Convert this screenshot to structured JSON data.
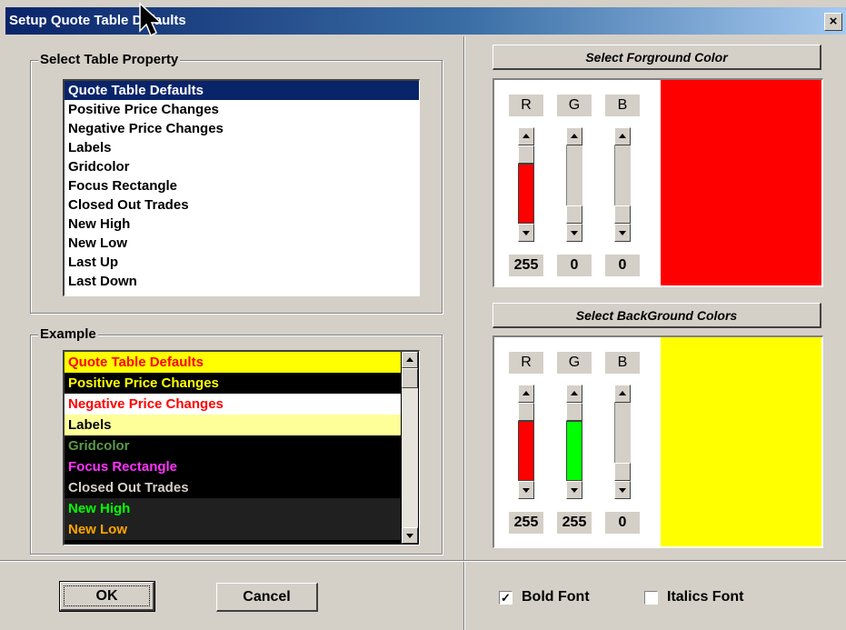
{
  "window": {
    "title": "Setup Quote Table Defaults",
    "close_glyph": "×"
  },
  "property_group": {
    "legend": "Select Table Property",
    "items": [
      "Quote Table Defaults",
      "Positive Price Changes",
      "Negative Price Changes",
      "Labels",
      "Gridcolor",
      "Focus Rectangle",
      "Closed Out Trades",
      "New High",
      "New Low",
      "Last Up",
      "Last Down"
    ],
    "selected_index": 0
  },
  "example_group": {
    "legend": "Example",
    "items": [
      {
        "label": "Quote Table Defaults",
        "fg": "#ff0000",
        "bg": "#ffff00"
      },
      {
        "label": "Positive Price Changes",
        "fg": "#ffff00",
        "bg": "#000000"
      },
      {
        "label": "Negative Price Changes",
        "fg": "#ff0000",
        "bg": "#ffffff"
      },
      {
        "label": "Labels",
        "fg": "#000000",
        "bg": "#ffff99"
      },
      {
        "label": "Gridcolor",
        "fg": "#5a9a4a",
        "bg": "#000000"
      },
      {
        "label": "Focus Rectangle",
        "fg": "#ff33ff",
        "bg": "#000000"
      },
      {
        "label": "Closed Out Trades",
        "fg": "#d4d0c8",
        "bg": "#000000"
      },
      {
        "label": "New High",
        "fg": "#00ff00",
        "bg": "#202020"
      },
      {
        "label": "New Low",
        "fg": "#ffa500",
        "bg": "#202020"
      }
    ],
    "scroll_fraction": 0.0
  },
  "foreground": {
    "header": "Select Forground Color",
    "channels": [
      {
        "name": "R",
        "value": "255",
        "color": "#ff0000"
      },
      {
        "name": "G",
        "value": "0",
        "color": "#00ff00"
      },
      {
        "name": "B",
        "value": "0",
        "color": "#0000ff"
      }
    ],
    "swatch": "#ff0000"
  },
  "background": {
    "header": "Select BackGround Colors",
    "channels": [
      {
        "name": "R",
        "value": "255",
        "color": "#ff0000"
      },
      {
        "name": "G",
        "value": "255",
        "color": "#00ff00"
      },
      {
        "name": "B",
        "value": "0",
        "color": "#0000ff"
      }
    ],
    "swatch": "#ffff00"
  },
  "buttons": {
    "ok": "OK",
    "cancel": "Cancel"
  },
  "options": {
    "bold_font": {
      "label": "Bold Font",
      "checked": true
    },
    "italics_font": {
      "label": "Italics Font",
      "checked": false
    }
  }
}
